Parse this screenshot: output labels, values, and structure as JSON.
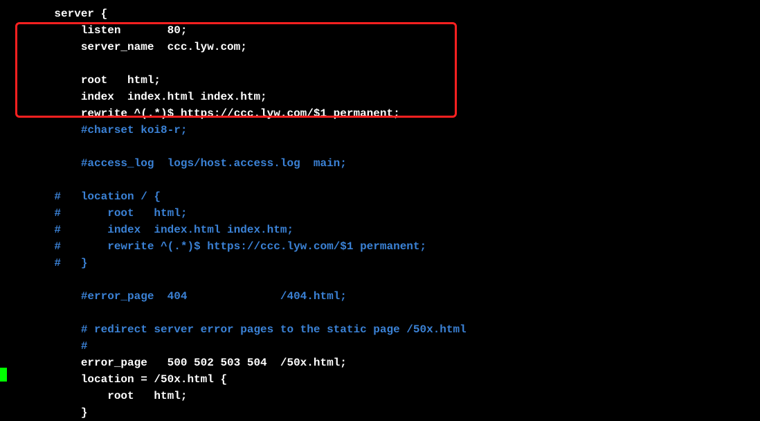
{
  "lines": [
    {
      "indent": "    ",
      "cls": "white",
      "text": "server {"
    },
    {
      "indent": "        ",
      "cls": "white",
      "text": "listen       80;"
    },
    {
      "indent": "        ",
      "cls": "white",
      "text": "server_name  ccc.lyw.com;"
    },
    {
      "indent": "",
      "cls": "white",
      "text": ""
    },
    {
      "indent": "        ",
      "cls": "white",
      "text": "root   html;"
    },
    {
      "indent": "        ",
      "cls": "white",
      "text": "index  index.html index.htm;"
    },
    {
      "indent": "        ",
      "cls": "white",
      "text": "rewrite ^(.*)$ https://ccc.lyw.com/$1 permanent;"
    },
    {
      "indent": "        ",
      "cls": "blue",
      "text": "#charset koi8-r;"
    },
    {
      "indent": "",
      "cls": "white",
      "text": ""
    },
    {
      "indent": "        ",
      "cls": "blue",
      "text": "#access_log  logs/host.access.log  main;"
    },
    {
      "indent": "",
      "cls": "white",
      "text": ""
    },
    {
      "indent": "    ",
      "cls": "blue",
      "text": "#   location / {"
    },
    {
      "indent": "    ",
      "cls": "blue",
      "text": "#       root   html;"
    },
    {
      "indent": "    ",
      "cls": "blue",
      "text": "#       index  index.html index.htm;"
    },
    {
      "indent": "    ",
      "cls": "blue",
      "text": "#       rewrite ^(.*)$ https://ccc.lyw.com/$1 permanent;"
    },
    {
      "indent": "    ",
      "cls": "blue",
      "text": "#   }"
    },
    {
      "indent": "",
      "cls": "white",
      "text": ""
    },
    {
      "indent": "        ",
      "cls": "blue",
      "text": "#error_page  404              /404.html;"
    },
    {
      "indent": "",
      "cls": "white",
      "text": ""
    },
    {
      "indent": "        ",
      "cls": "blue",
      "text": "# redirect server error pages to the static page /50x.html"
    },
    {
      "indent": "        ",
      "cls": "blue",
      "text": "#"
    },
    {
      "indent": "        ",
      "cls": "white",
      "text": "error_page   500 502 503 504  /50x.html;"
    },
    {
      "indent": "        ",
      "cls": "white",
      "text": "location = /50x.html {"
    },
    {
      "indent": "            ",
      "cls": "white",
      "text": "root   html;"
    },
    {
      "indent": "        ",
      "cls": "white",
      "text": "}"
    }
  ]
}
